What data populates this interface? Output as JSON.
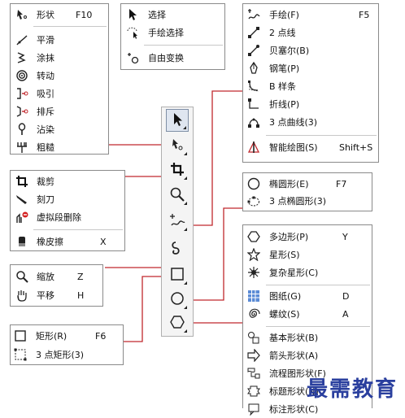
{
  "colors": {
    "connector": "#c0282d",
    "watermark": "#2a3f9e",
    "menu_border": "#8a8a8a"
  },
  "shape_menu": {
    "items": [
      {
        "icon": "shape-edit-icon",
        "label": "形状",
        "shortcut": "F10"
      },
      {
        "icon": "smooth-icon",
        "label": "平滑",
        "shortcut": ""
      },
      {
        "icon": "smear-icon",
        "label": "涂抹",
        "shortcut": ""
      },
      {
        "icon": "twirl-icon",
        "label": "转动",
        "shortcut": ""
      },
      {
        "icon": "attract-icon",
        "label": "吸引",
        "shortcut": ""
      },
      {
        "icon": "repel-icon",
        "label": "排斥",
        "shortcut": ""
      },
      {
        "icon": "smudge-icon",
        "label": "沾染",
        "shortcut": ""
      },
      {
        "icon": "roughen-icon",
        "label": "粗糙",
        "shortcut": ""
      }
    ]
  },
  "pick_menu": {
    "items": [
      {
        "icon": "pick-arrow-icon",
        "label": "选择"
      },
      {
        "icon": "freehand-pick-icon",
        "label": "手绘选择"
      },
      {
        "icon": "free-transform-icon",
        "label": "自由变换"
      }
    ]
  },
  "crop_menu": {
    "items": [
      {
        "icon": "crop-icon",
        "label": "裁剪",
        "shortcut": ""
      },
      {
        "icon": "knife-icon",
        "label": "刻刀",
        "shortcut": ""
      },
      {
        "icon": "virtual-segment-delete-icon",
        "label": "虚拟段删除",
        "shortcut": ""
      },
      {
        "icon": "eraser-icon",
        "label": "橡皮擦",
        "shortcut": "X"
      }
    ]
  },
  "zoom_menu": {
    "items": [
      {
        "icon": "zoom-icon",
        "label": "缩放",
        "shortcut": "Z"
      },
      {
        "icon": "pan-hand-icon",
        "label": "平移",
        "shortcut": "H"
      }
    ]
  },
  "rect_menu": {
    "items": [
      {
        "icon": "rectangle-icon",
        "label": "矩形(R)",
        "shortcut": "F6"
      },
      {
        "icon": "three-point-rectangle-icon",
        "label": "3 点矩形(3)",
        "shortcut": ""
      }
    ]
  },
  "curve_menu": {
    "items": [
      {
        "icon": "freehand-icon",
        "label": "手绘(F)",
        "shortcut": "F5"
      },
      {
        "icon": "two-point-line-icon",
        "label": "2 点线",
        "shortcut": ""
      },
      {
        "icon": "bezier-icon",
        "label": "贝塞尔(B)",
        "shortcut": ""
      },
      {
        "icon": "pen-icon",
        "label": "钢笔(P)",
        "shortcut": ""
      },
      {
        "icon": "b-spline-icon",
        "label": "B 样条",
        "shortcut": ""
      },
      {
        "icon": "polyline-icon",
        "label": "折线(P)",
        "shortcut": ""
      },
      {
        "icon": "three-point-curve-icon",
        "label": "3 点曲线(3)",
        "shortcut": ""
      },
      {
        "icon": "smart-drawing-icon",
        "label": "智能绘图(S)",
        "shortcut": "Shift+S"
      }
    ]
  },
  "ellipse_menu": {
    "items": [
      {
        "icon": "ellipse-icon",
        "label": "椭圆形(E)",
        "shortcut": "F7"
      },
      {
        "icon": "three-point-ellipse-icon",
        "label": "3 点椭圆形(3)",
        "shortcut": ""
      }
    ]
  },
  "polygon_menu": {
    "items": [
      {
        "icon": "polygon-icon",
        "label": "多边形(P)",
        "shortcut": "Y"
      },
      {
        "icon": "star-icon",
        "label": "星形(S)",
        "shortcut": ""
      },
      {
        "icon": "complex-star-icon",
        "label": "复杂星形(C)",
        "shortcut": ""
      },
      {
        "icon": "graph-paper-icon",
        "label": "图纸(G)",
        "shortcut": "D"
      },
      {
        "icon": "spiral-icon",
        "label": "螺纹(S)",
        "shortcut": "A"
      },
      {
        "icon": "basic-shapes-icon",
        "label": "基本形状(B)",
        "shortcut": ""
      },
      {
        "icon": "arrow-shapes-icon",
        "label": "箭头形状(A)",
        "shortcut": ""
      },
      {
        "icon": "flowchart-shapes-icon",
        "label": "流程图形状(F)",
        "shortcut": ""
      },
      {
        "icon": "banner-shapes-icon",
        "label": "标题形状(N)",
        "shortcut": ""
      },
      {
        "icon": "callout-shapes-icon",
        "label": "标注形状(C)",
        "shortcut": ""
      }
    ]
  },
  "toolbar": {
    "tools": [
      {
        "icon": "pick-tool-icon"
      },
      {
        "icon": "shape-tool-icon"
      },
      {
        "icon": "crop-tool-icon"
      },
      {
        "icon": "zoom-tool-icon"
      },
      {
        "icon": "freehand-tool-icon"
      },
      {
        "icon": "artistic-media-tool-icon"
      },
      {
        "icon": "rectangle-tool-icon"
      },
      {
        "icon": "ellipse-tool-icon"
      },
      {
        "icon": "polygon-tool-icon"
      }
    ]
  },
  "watermark": "最需教育"
}
